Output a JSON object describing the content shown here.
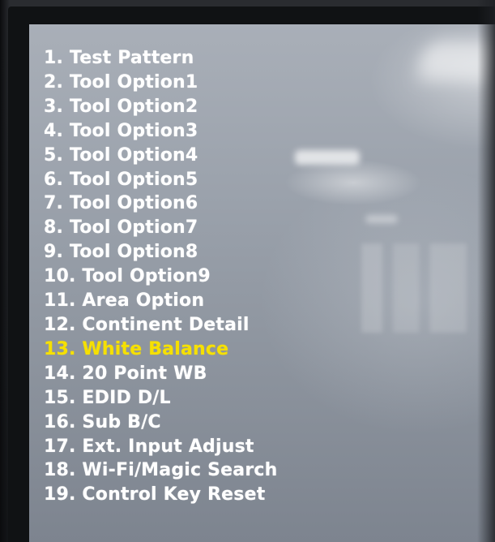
{
  "menu": {
    "items": [
      {
        "label": "1. Test Pattern"
      },
      {
        "label": "2. Tool Option1"
      },
      {
        "label": "3. Tool Option2"
      },
      {
        "label": "4. Tool Option3"
      },
      {
        "label": "5. Tool Option4"
      },
      {
        "label": "6. Tool Option5"
      },
      {
        "label": "7. Tool Option6"
      },
      {
        "label": "8. Tool Option7"
      },
      {
        "label": "9. Tool Option8"
      },
      {
        "label": "10. Tool Option9"
      },
      {
        "label": "11. Area Option"
      },
      {
        "label": "12. Continent Detail"
      },
      {
        "label": "13. White Balance"
      },
      {
        "label": "14. 20 Point WB"
      },
      {
        "label": "15. EDID D/L"
      },
      {
        "label": "16. Sub B/C"
      },
      {
        "label": "17. Ext. Input Adjust"
      },
      {
        "label": "18. Wi-Fi/Magic Search"
      },
      {
        "label": "19. Control Key Reset"
      }
    ],
    "selected_label": "13. White Balance"
  },
  "colors": {
    "text": "#ffffff",
    "selected": "#f6e000",
    "screen_background": "#9aa1ab"
  }
}
